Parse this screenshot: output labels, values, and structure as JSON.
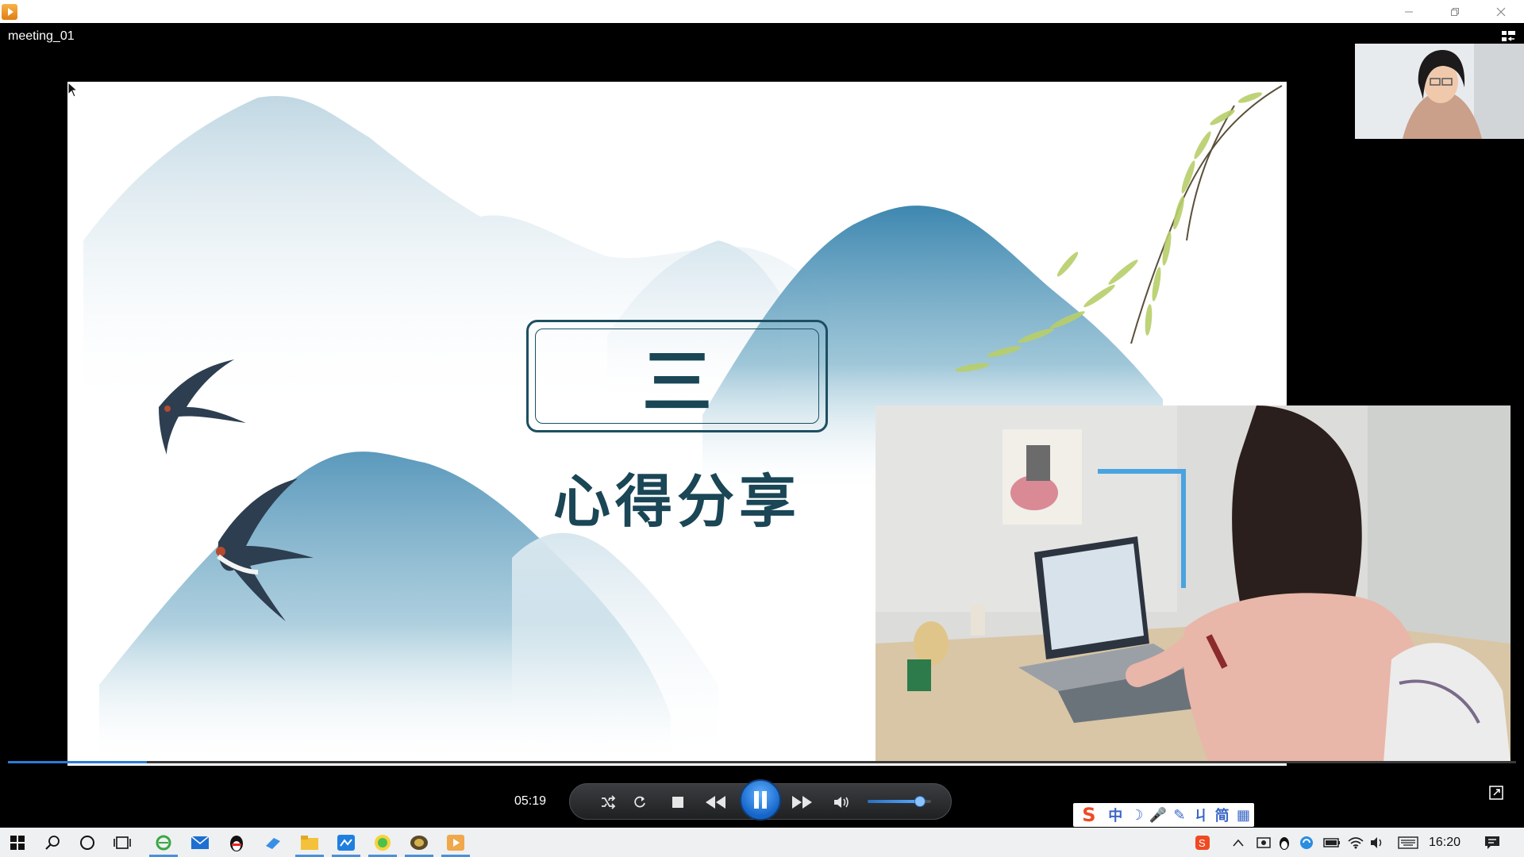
{
  "window": {
    "title": "meeting_01",
    "controls": [
      "minimize-icon",
      "restore-icon",
      "close-icon"
    ]
  },
  "slide": {
    "section_number": "三",
    "section_title": "心得分享"
  },
  "player": {
    "elapsed_time": "05:19",
    "progress_fraction": 0.092,
    "volume_fraction": 0.82,
    "state": "playing",
    "accent_color": "#2d7bd6"
  },
  "ime_toolbar": {
    "items": [
      "S",
      "中",
      "☽",
      "🎤",
      "✎",
      "ㄐ",
      "简",
      "▦"
    ]
  },
  "taskbar": {
    "clock": "16:20",
    "colors": {
      "background": "#eef0f1",
      "active_indicator": "#4a90d9"
    }
  }
}
